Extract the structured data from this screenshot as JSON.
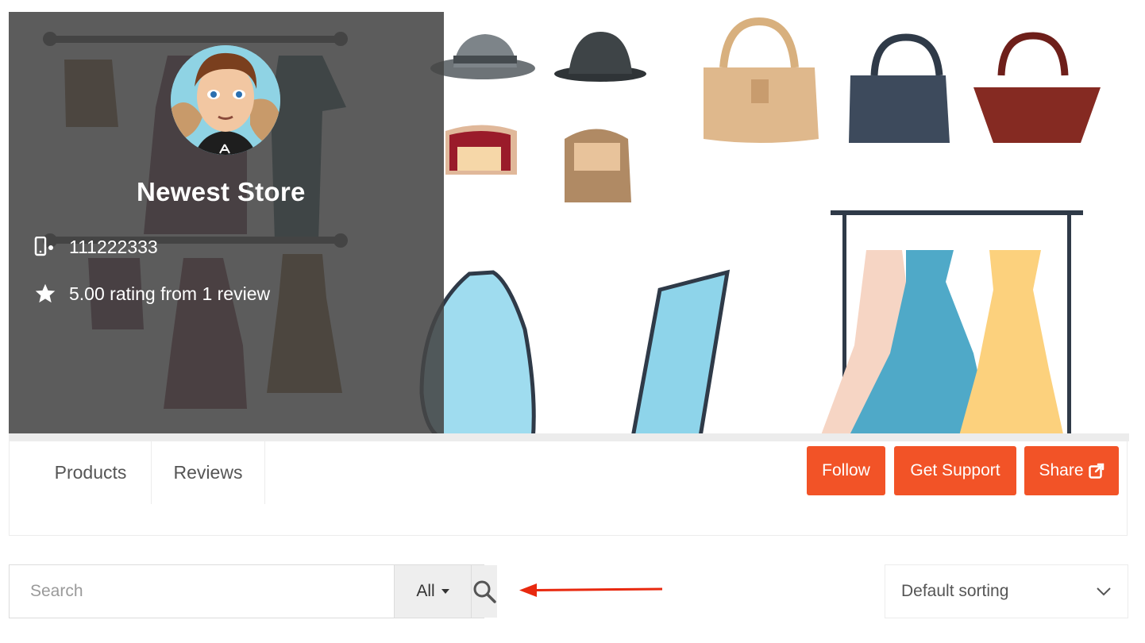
{
  "store": {
    "name": "Newest Store",
    "phone": "111222333",
    "rating": "5.00 rating from 1 review"
  },
  "tabs": [
    {
      "label": "Products"
    },
    {
      "label": "Reviews"
    }
  ],
  "actions": {
    "follow": "Follow",
    "support": "Get Support",
    "share": "Share"
  },
  "search": {
    "placeholder": "Search",
    "filter": "All"
  },
  "sort": {
    "selected": "Default sorting"
  },
  "icons": {
    "phone": "mobile-phone-icon",
    "rating": "star-icon",
    "share": "external-link-icon",
    "search": "magnifier-icon",
    "sort": "chevron-down-icon",
    "arrow": "arrow-left-icon"
  },
  "colors": {
    "accent": "#f25327",
    "overlay": "#464646",
    "arrow": "#e8290f"
  }
}
